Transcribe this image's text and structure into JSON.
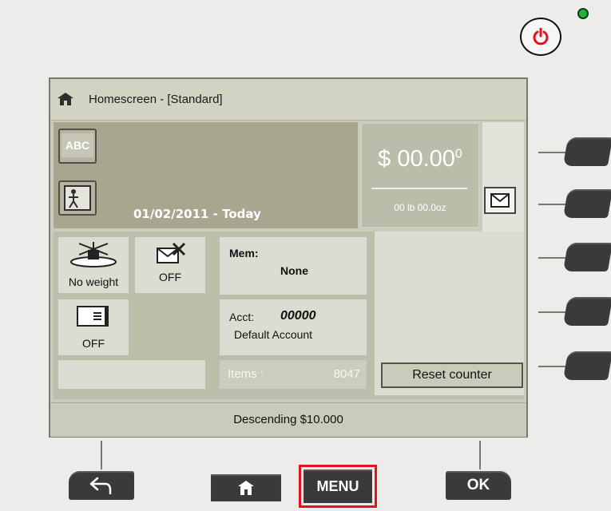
{
  "window": {
    "title": "Homescreen - [Standard]"
  },
  "header": {
    "abc_button": "ABC",
    "date": "01/02/2011 - Today",
    "amount_main": "$ 00.00",
    "amount_sup": "0",
    "weight": "00 lb 00.0oz"
  },
  "tiles": {
    "scale_label": "No weight",
    "envelope_status": "OFF",
    "card_status": "OFF"
  },
  "memory": {
    "label": "Mem:",
    "value": "None"
  },
  "account": {
    "label": "Acct:",
    "number": "00000",
    "name": "Default Account"
  },
  "counter": {
    "items_label": "Items :",
    "items_value": "8047",
    "reset_label": "Reset counter"
  },
  "status": {
    "text": "Descending $10.000"
  },
  "keys": {
    "menu": "MENU",
    "ok": "OK"
  },
  "colors": {
    "power": "#e1141d",
    "led": "#1fb33a",
    "highlight": "#e1141d"
  },
  "icons": [
    "power-icon",
    "home-icon",
    "person-icon",
    "envelope-icon",
    "scale-icon",
    "envelope-off-icon",
    "card-icon",
    "back-arrow-icon"
  ]
}
